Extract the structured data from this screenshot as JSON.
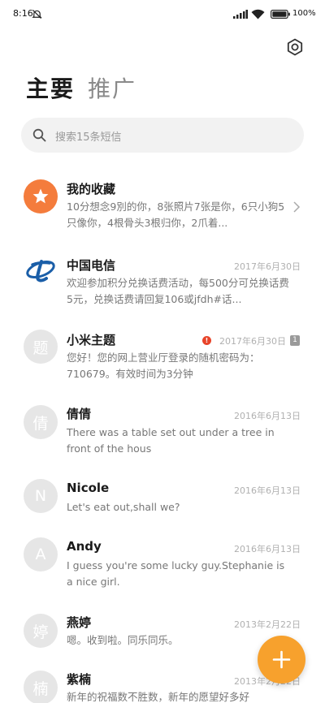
{
  "status_bar": {
    "time": "8:16",
    "battery": "100%"
  },
  "header": {
    "tab_main": "主要",
    "tab_promo": "推广"
  },
  "search": {
    "placeholder": "搜索15条短信"
  },
  "colors": {
    "accent": "#f47c3c",
    "fab": "#f7a12d",
    "alert": "#e8442a"
  },
  "messages": [
    {
      "name": "我的收藏",
      "date": "",
      "avatar_icon": "star-icon",
      "preview": "10分想念9別的你，8张照片7张是你，6只小狗5只像你，4根骨头3根归你，2爪着..."
    },
    {
      "name": "中国电信",
      "date": "2017年6月30日",
      "avatar_icon": "china-telecom-logo-icon",
      "preview": "欢迎参加积分兑换话费活动，每500分可兑换话费5元，兑换话费请回复106或jfdh#话..."
    },
    {
      "name": "小米主题",
      "date": "2017年6月30日",
      "avatar": "题",
      "alert": "!",
      "sim": "1",
      "preview": "您好！您的网上营业厅登录的随机密码为：710679。有效时间为3分钟"
    },
    {
      "name": "倩倩",
      "date": "2016年6月13日",
      "avatar": "倩",
      "preview": "There was a table set out under a tree in front of the hous"
    },
    {
      "name": "Nicole",
      "date": "2016年6月13日",
      "avatar": "N",
      "preview": "Let's eat out,shall we?"
    },
    {
      "name": "Andy",
      "date": "2016年6月13日",
      "avatar": "A",
      "preview": "I guess you're some lucky guy.Stephanie is a nice girl."
    },
    {
      "name": "燕婷",
      "date": "2013年2月22日",
      "avatar": "婷",
      "preview": "嗯。收到啦。同乐同乐。"
    },
    {
      "name": "紫楠",
      "date": "2013年2月22日",
      "avatar": "楠",
      "preview": "新年的祝福数不胜数，新年的愿望好多好"
    }
  ]
}
